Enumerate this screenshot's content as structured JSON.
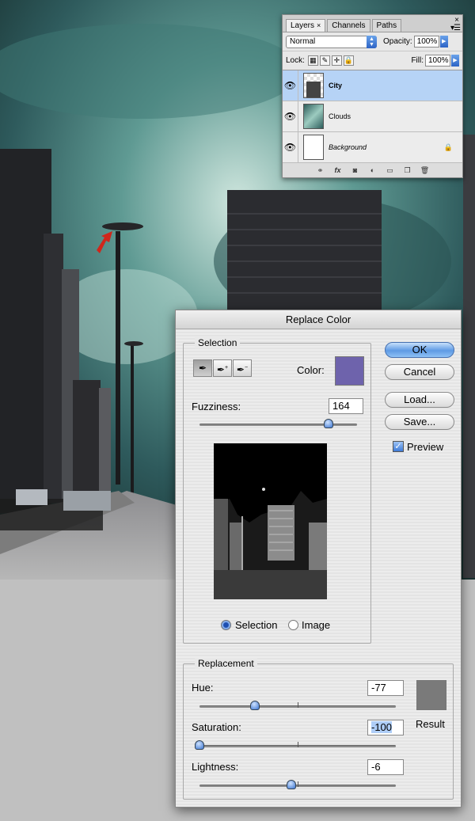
{
  "layers_panel": {
    "tabs": [
      "Layers",
      "Channels",
      "Paths"
    ],
    "tab_close": "×",
    "close": "×",
    "blend_mode": "Normal",
    "opacity_label": "Opacity:",
    "opacity_value": "100%",
    "lock_label": "Lock:",
    "fill_label": "Fill:",
    "fill_value": "100%",
    "layers": [
      {
        "name": "City",
        "selected": true
      },
      {
        "name": "Clouds",
        "selected": false
      },
      {
        "name": "Background",
        "selected": false
      }
    ]
  },
  "dialog": {
    "title": "Replace Color",
    "selection": {
      "group_label": "Selection",
      "color_label": "Color:",
      "color": "#6e63ac",
      "fuzziness_label": "Fuzziness:",
      "fuzziness_value": "164",
      "fuzziness_fraction": 0.82,
      "radio_selection": "Selection",
      "radio_image": "Image",
      "selected_radio": "Selection"
    },
    "buttons": {
      "ok": "OK",
      "cancel": "Cancel",
      "load": "Load...",
      "save": "Save..."
    },
    "preview_label": "Preview",
    "preview_checked": true,
    "replacement": {
      "group_label": "Replacement",
      "hue_label": "Hue:",
      "hue_value": "-77",
      "saturation_label": "Saturation:",
      "saturation_value": "-100",
      "lightness_label": "Lightness:",
      "lightness_value": "-6",
      "result_label": "Result",
      "result_color": "#7a7a7a"
    }
  }
}
